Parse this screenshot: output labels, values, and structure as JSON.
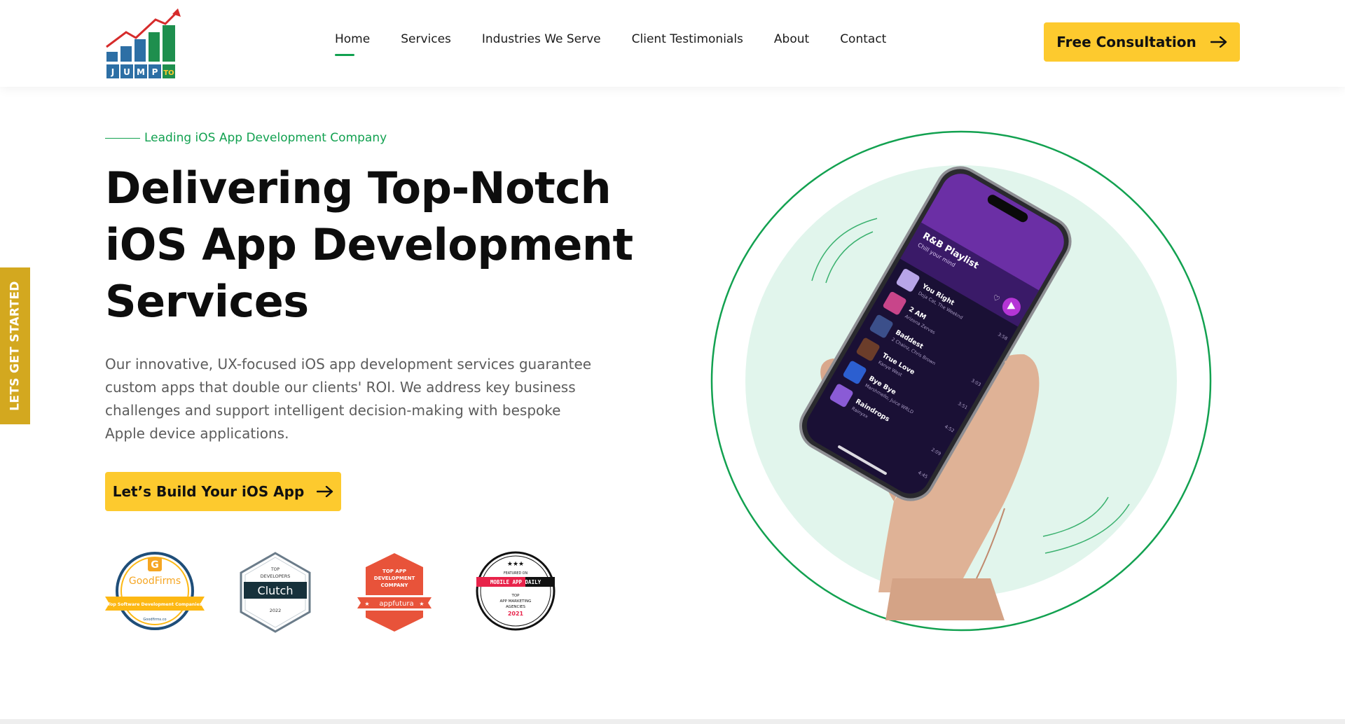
{
  "header": {
    "logo_letters": [
      "J",
      "U",
      "M",
      "P",
      "TO"
    ],
    "nav": [
      {
        "label": "Home",
        "active": true
      },
      {
        "label": "Services",
        "active": false
      },
      {
        "label": "Industries We Serve",
        "active": false
      },
      {
        "label": "Client Testimonials",
        "active": false
      },
      {
        "label": "About",
        "active": false
      },
      {
        "label": "Contact",
        "active": false
      }
    ],
    "cta_label": "Free Consultation",
    "cta_icon": "arrow-right-icon"
  },
  "side_tab": {
    "label": "LETS GET STARTED"
  },
  "hero": {
    "eyebrow": "Leading iOS App Development Company",
    "title_lines": [
      "Delivering Top-Notch",
      "iOS App Development",
      "Services"
    ],
    "description": "Our innovative, UX-focused iOS app development services guarantee custom apps that double our clients' ROI. We address key business challenges and support intelligent decision-making with bespoke Apple device applications.",
    "cta_label": "Let’s Build Your iOS App",
    "cta_icon": "arrow-right-icon"
  },
  "badges": {
    "goodfirms": {
      "name": "GoodFirms",
      "ribbon": "Top Software Development Companies",
      "url": "Goodfirms.co"
    },
    "clutch": {
      "top": "TOP",
      "sub": "DEVELOPERS",
      "name": "Clutch",
      "year": "2022"
    },
    "appfutura": {
      "line1": "TOP APP",
      "line2": "DEVELOPMENT",
      "line3": "COMPANY",
      "name": "appfutura"
    },
    "mobile_app_daily": {
      "featured": "FEATURED ON",
      "name": "MOBILE APP DAILY",
      "line1": "TOP",
      "line2": "APP MARKETING",
      "line3": "AGENCIES",
      "year": "2021"
    }
  },
  "phone": {
    "playlist_title": "R&B Playlist",
    "playlist_subtitle": "Chill your mind",
    "tracks": [
      {
        "title": "You Right",
        "artist": "Doja Cat, The Weeknd",
        "duration": "3:58"
      },
      {
        "title": "2 AM",
        "artist": "Arizona Zervas",
        "duration": ""
      },
      {
        "title": "Baddest",
        "artist": "2 Chainz, Chris Brown",
        "duration": "3:03"
      },
      {
        "title": "True Love",
        "artist": "Kanye West",
        "duration": "3:51"
      },
      {
        "title": "Bye Bye",
        "artist": "Marshmello, Juice WRLD",
        "duration": "4:52"
      },
      {
        "title": "Raindrops",
        "artist": "Rainyxx",
        "duration": "2:09"
      },
      {
        "title": "",
        "artist": "",
        "duration": "4:45"
      }
    ]
  },
  "colors": {
    "accent_yellow": "#fdca2e",
    "brand_green": "#12a150",
    "side_tab": "#d3a81f",
    "circle_fill": "#e1f5ec"
  }
}
